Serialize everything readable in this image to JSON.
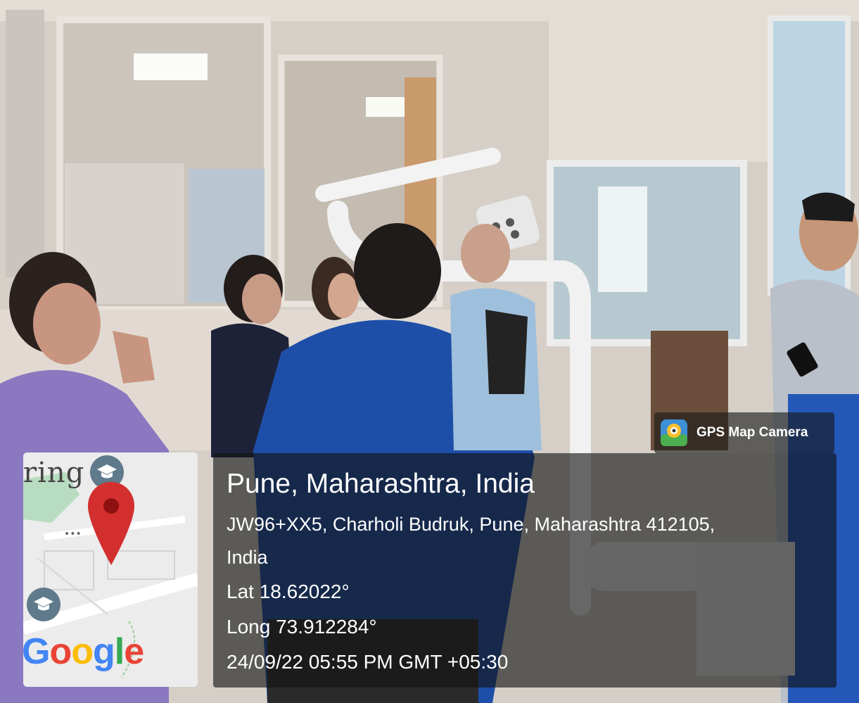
{
  "photo": {
    "description_icon": "camera-photo",
    "colors": {
      "wall": "#d9d2ca",
      "shirt_blue": "#1e4fa8",
      "saree_lavender": "#8a78c0",
      "panel_overlay": "#121212"
    }
  },
  "gps_badge": {
    "label": "GPS Map Camera",
    "icon": "gps-map-camera-logo-icon"
  },
  "location": {
    "title": "Pune, Maharashtra, India",
    "address_line1": "JW96+XX5, Charholi Budruk, Pune, Maharashtra 412105,",
    "address_line2": "India",
    "latitude": "Lat 18.62022°",
    "longitude": "Long 73.912284°",
    "timestamp": "24/09/22 05:55 PM GMT +05:30"
  },
  "map_thumbnail": {
    "snippet_text": "ring",
    "logo_text": [
      "G",
      "o",
      "o",
      "g",
      "l",
      "e"
    ],
    "logo_colors": [
      "#4285F4",
      "#EA4335",
      "#FBBC05",
      "#4285F4",
      "#34A853",
      "#EA4335"
    ],
    "pin_color": "#d32f2f",
    "icons": [
      "graduation-cap-icon",
      "location-pin-icon"
    ]
  }
}
